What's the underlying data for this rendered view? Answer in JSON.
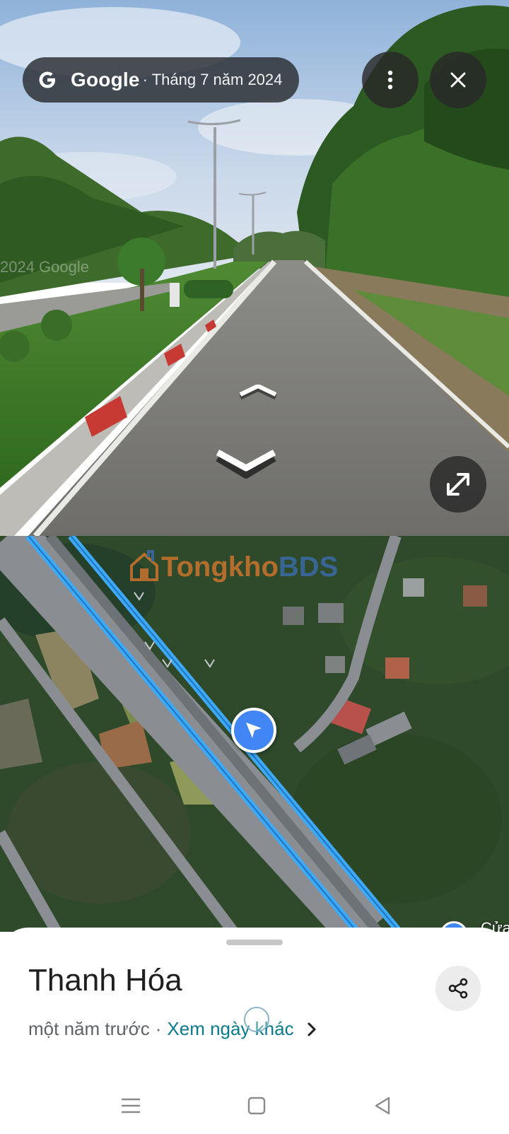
{
  "streetview": {
    "brand": "Google",
    "date": "· Tháng 7 năm 2024",
    "watermark": "2024 Google",
    "logo_icon": "google-g-icon",
    "more_icon": "more-vert-icon",
    "close_icon": "close-icon",
    "expand_icon": "expand-icon",
    "forward_icon": "chevron-up-icon",
    "backward_icon": "chevron-down-icon"
  },
  "map": {
    "watermark_tong": "Tongkho",
    "watermark_bds": "BDS",
    "poi_label": "Cửa",
    "marker_icon": "navigation-arrow-icon",
    "route_color": "#3fa9f5"
  },
  "sheet": {
    "title": "Thanh Hóa",
    "time_ago": "một năm trước",
    "separator": "·",
    "other_dates_link": "Xem ngày khác",
    "share_icon": "share-icon",
    "chevron_icon": "chevron-right-icon",
    "link_color": "#0b7a8c"
  },
  "navbar": {
    "menu_icon": "menu-icon",
    "home_icon": "home-square-icon",
    "back_icon": "back-triangle-icon"
  }
}
